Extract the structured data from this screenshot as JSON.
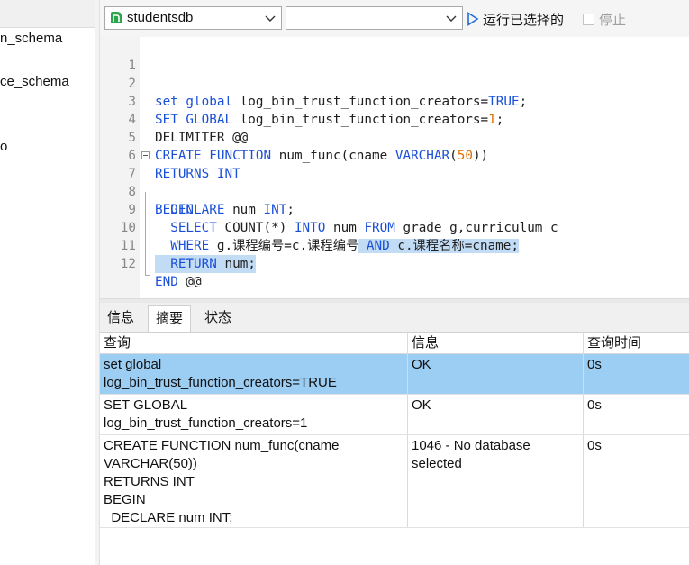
{
  "sidebar": {
    "items": [
      "n_schema",
      "ce_schema",
      "o"
    ]
  },
  "toolbar": {
    "database": "studentsdb",
    "second_select": "",
    "run_label": "运行已选择的",
    "stop_label": "停止"
  },
  "editor": {
    "lines": [
      {
        "n": "1"
      },
      {
        "n": "2"
      },
      {
        "n": "3"
      },
      {
        "n": "4"
      },
      {
        "n": "5"
      },
      {
        "n": "6"
      },
      {
        "n": "7"
      },
      {
        "n": "8"
      },
      {
        "n": "9"
      },
      {
        "n": "10"
      },
      {
        "n": "11"
      },
      {
        "n": "12"
      }
    ],
    "code": {
      "l2": [
        "set global",
        " log_bin_trust_function_creators=",
        "TRUE",
        ";"
      ],
      "l3": [
        "SET GLOBAL",
        " log_bin_trust_function_creators=",
        "1",
        ";"
      ],
      "l4": "DELIMITER @@",
      "l5": [
        "CREATE FUNCTION",
        " num_func(cname ",
        "VARCHAR",
        "(",
        "50",
        "))"
      ],
      "l6": "RETURNS INT",
      "l7": "BEGIN",
      "l8": [
        "  DECLARE",
        " num ",
        "INT",
        ";"
      ],
      "l9": [
        "  SELECT",
        " COUNT(*) ",
        "INTO",
        " num ",
        "FROM",
        " grade g,curriculum c"
      ],
      "l10": [
        "  WHERE",
        " g.课程编号=c.课程编号",
        " AND",
        " c.课程名称=cname;"
      ],
      "l11": [
        "  RETURN",
        " num;"
      ],
      "l12": [
        "END",
        " @@"
      ]
    }
  },
  "tabs": [
    {
      "label": "信息"
    },
    {
      "label": "摘要"
    },
    {
      "label": "状态"
    }
  ],
  "results": {
    "headers": [
      "查询",
      "信息",
      "查询时间"
    ],
    "rows": [
      {
        "query": "set global\nlog_bin_trust_function_creators=TRUE",
        "info": "OK",
        "time": "0s"
      },
      {
        "query": "SET GLOBAL\nlog_bin_trust_function_creators=1",
        "info": "OK",
        "time": "0s"
      },
      {
        "query": "CREATE FUNCTION num_func(cname\nVARCHAR(50))\nRETURNS INT\nBEGIN\n  DECLARE num INT;",
        "info": "1046 - No database\nselected",
        "time": "0s"
      }
    ]
  },
  "colors": {
    "keyword": "#1a4fd8",
    "number": "#e06c00",
    "selection": "#c2dcf5",
    "row_selected": "#9ccdf3",
    "db_icon": "#2ea44f",
    "run_icon": "#1e6fd9"
  }
}
